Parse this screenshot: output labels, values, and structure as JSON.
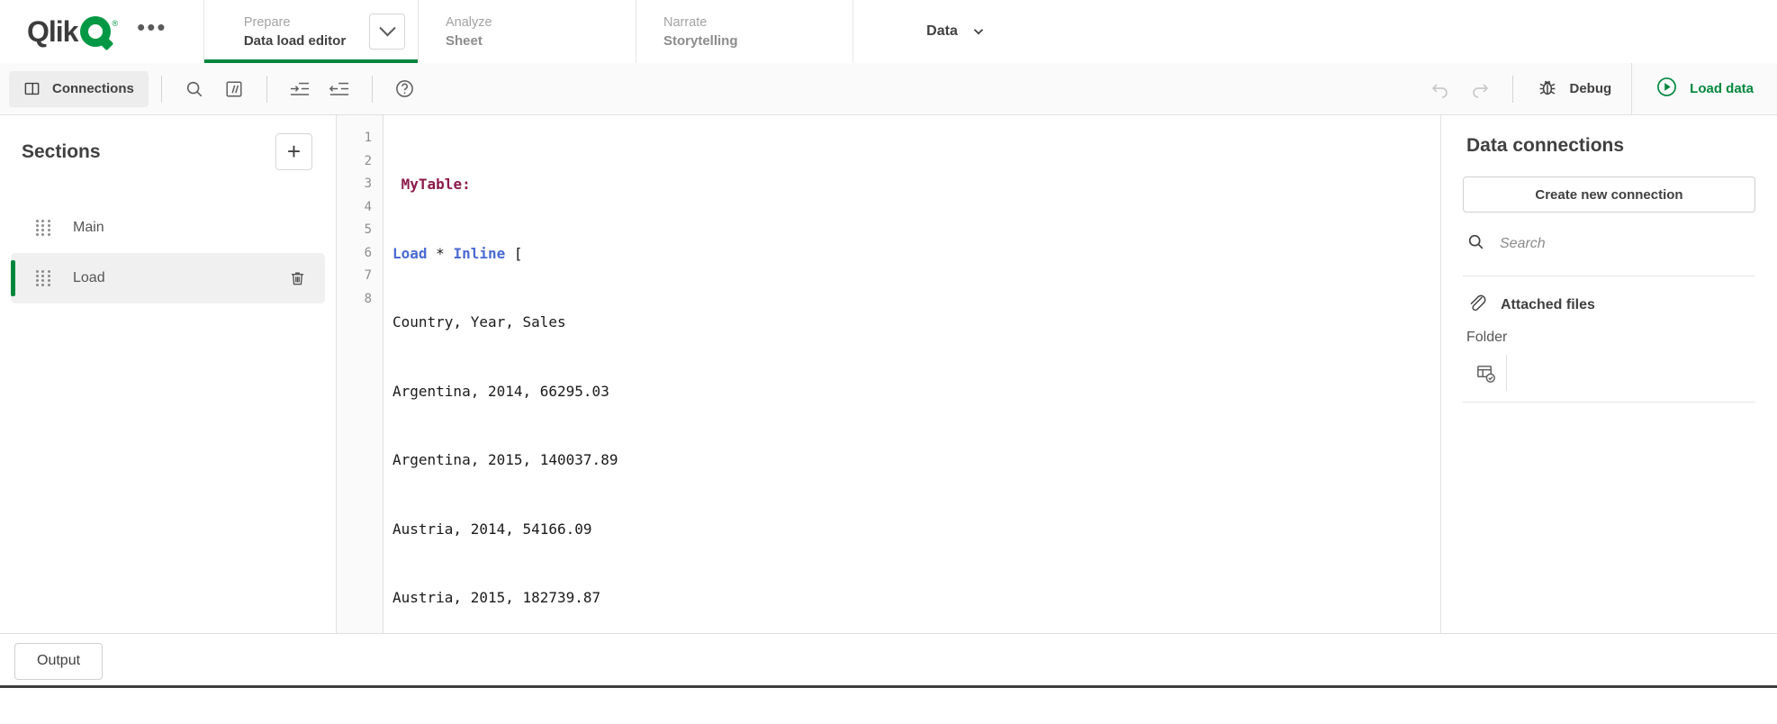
{
  "brand": {
    "name": "Qlik",
    "registered": "®",
    "accent_green": "#00873d",
    "logo_dark": "#3c3c3c"
  },
  "topnav": {
    "overflow_label": "•••",
    "tabs": [
      {
        "kicker": "Prepare",
        "title": "Data load editor",
        "active": true,
        "has_chevron": true
      },
      {
        "kicker": "Analyze",
        "title": "Sheet",
        "active": false,
        "has_chevron": false
      },
      {
        "kicker": "Narrate",
        "title": "Storytelling",
        "active": false,
        "has_chevron": false
      }
    ],
    "data_menu": {
      "label": "Data"
    }
  },
  "toolbar": {
    "connections_label": "Connections",
    "icons": [
      {
        "name": "search-icon",
        "title": "Search"
      },
      {
        "name": "comment-icon",
        "title": "Comment"
      },
      {
        "name": "indent-icon",
        "title": "Indent"
      },
      {
        "name": "outdent-icon",
        "title": "Outdent"
      },
      {
        "name": "help-icon",
        "title": "Help"
      }
    ],
    "undo_title": "Undo",
    "redo_title": "Redo",
    "debug_label": "Debug",
    "load_data_label": "Load data"
  },
  "sidebar": {
    "title": "Sections",
    "add_label": "+",
    "sections": [
      {
        "label": "Main",
        "selected": false,
        "deletable": false
      },
      {
        "label": "Load",
        "selected": true,
        "deletable": true
      }
    ]
  },
  "editor": {
    "line_numbers": [
      "1",
      "2",
      "3",
      "4",
      "5",
      "6",
      "7",
      "8"
    ],
    "lines": [
      {
        "text": " MyTable:",
        "type": "table"
      },
      {
        "text": "Load * Inline [",
        "type": "keywords"
      },
      {
        "text": "Country, Year, Sales",
        "type": "plain"
      },
      {
        "text": "Argentina, 2014, 66295.03",
        "type": "plain"
      },
      {
        "text": "Argentina, 2015, 140037.89",
        "type": "plain"
      },
      {
        "text": "Austria, 2014, 54166.09",
        "type": "plain"
      },
      {
        "text": "Austria, 2015, 182739.87",
        "type": "plain"
      },
      {
        "text": "];",
        "type": "plain"
      }
    ],
    "tokens": {
      "table_name": "MyTable",
      "table_colon": ":",
      "kw_load": "Load",
      "star": " * ",
      "kw_inline": "Inline",
      "bracket": " ["
    },
    "plain_lines": [
      "Country, Year, Sales",
      "Argentina, 2014, 66295.03",
      "Argentina, 2015, 140037.89",
      "Austria, 2014, 54166.09",
      "Austria, 2015, 182739.87",
      "];"
    ]
  },
  "rightpanel": {
    "title": "Data connections",
    "create_label": "Create new connection",
    "search_placeholder": "Search",
    "search_value": "",
    "attached_files_label": "Attached files",
    "folder_label": "Folder"
  },
  "bottom": {
    "output_label": "Output"
  }
}
